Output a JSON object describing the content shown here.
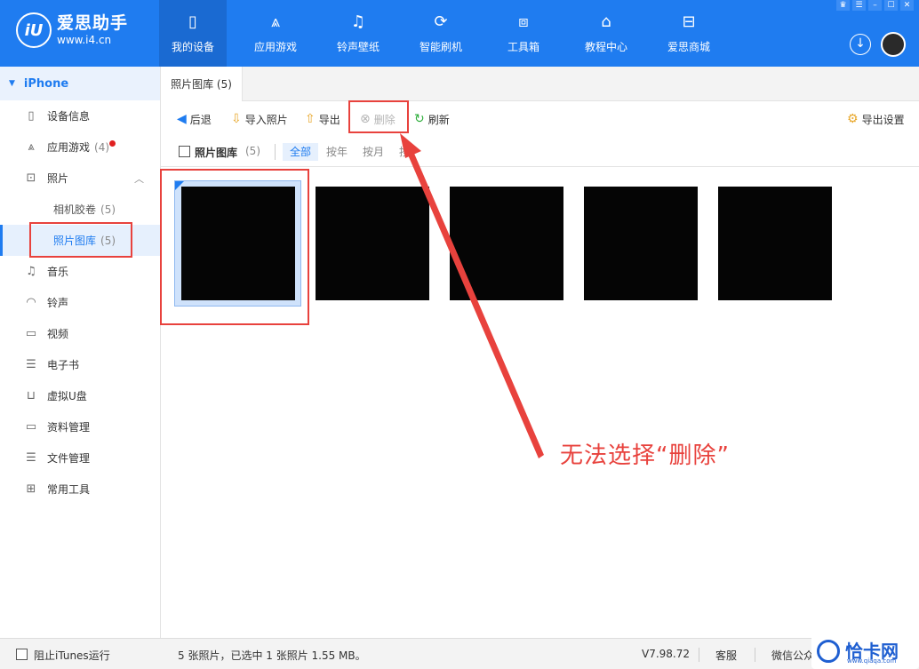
{
  "app": {
    "name": "爱思助手",
    "site": "www.i4.cn",
    "logo_mark": "iU"
  },
  "nav": [
    {
      "label": "我的设备",
      "icon": "phone-icon",
      "glyph": "▯"
    },
    {
      "label": "应用游戏",
      "icon": "apps-icon",
      "glyph": "⩓"
    },
    {
      "label": "铃声壁纸",
      "icon": "music-folder-icon",
      "glyph": "♫"
    },
    {
      "label": "智能刷机",
      "icon": "refresh-box-icon",
      "glyph": "⟳"
    },
    {
      "label": "工具箱",
      "icon": "toolbox-icon",
      "glyph": "⧈"
    },
    {
      "label": "教程中心",
      "icon": "graduation-cap-icon",
      "glyph": "⌂"
    },
    {
      "label": "爱思商城",
      "icon": "store-icon",
      "glyph": "⊟"
    }
  ],
  "window_controls": [
    "♛",
    "☰",
    "–",
    "☐",
    "✕"
  ],
  "download_glyph": "↓",
  "sidebar": {
    "device": "iPhone",
    "items": [
      {
        "label": "设备信息",
        "icon": "device-info-icon",
        "glyph": "▯"
      },
      {
        "label": "应用游戏",
        "count": "(4)",
        "icon": "apps-icon",
        "glyph": "⩓"
      },
      {
        "label": "照片",
        "icon": "photo-icon",
        "glyph": "⊡"
      },
      {
        "label": "相机胶卷",
        "count": "(5)"
      },
      {
        "label": "照片图库",
        "count": "(5)"
      },
      {
        "label": "音乐",
        "icon": "music-icon",
        "glyph": "♫"
      },
      {
        "label": "铃声",
        "icon": "bell-icon",
        "glyph": "◠"
      },
      {
        "label": "视频",
        "icon": "video-icon",
        "glyph": "▭"
      },
      {
        "label": "电子书",
        "icon": "book-icon",
        "glyph": "☰"
      },
      {
        "label": "虚拟U盘",
        "icon": "usb-icon",
        "glyph": "⊔"
      },
      {
        "label": "资料管理",
        "icon": "folder-icon",
        "glyph": "▭"
      },
      {
        "label": "文件管理",
        "icon": "file-icon",
        "glyph": "☰"
      },
      {
        "label": "常用工具",
        "icon": "grid-icon",
        "glyph": "⊞"
      }
    ]
  },
  "tab": "照片图库 (5)",
  "toolbar": {
    "back": "后退",
    "import": "导入照片",
    "export": "导出",
    "delete": "删除",
    "refresh": "刷新",
    "export_settings": "导出设置"
  },
  "filter": {
    "title": "照片图库",
    "count": "(5)",
    "options": [
      "全部",
      "按年",
      "按月",
      "按日"
    ]
  },
  "photos_count": 5,
  "annotation": "无法选择“删除”",
  "status": {
    "itunes": "阻止iTunes运行",
    "info": "5 张照片，已选中 1 张照片 1.55 MB。",
    "version": "V7.98.72",
    "service": "客服",
    "wechat": "微信公众号"
  },
  "watermark": {
    "text": "恰卡网",
    "site": "www.qiaqa.com"
  },
  "colors": {
    "accent": "#1f7cf0",
    "annotation": "#e8423d"
  }
}
